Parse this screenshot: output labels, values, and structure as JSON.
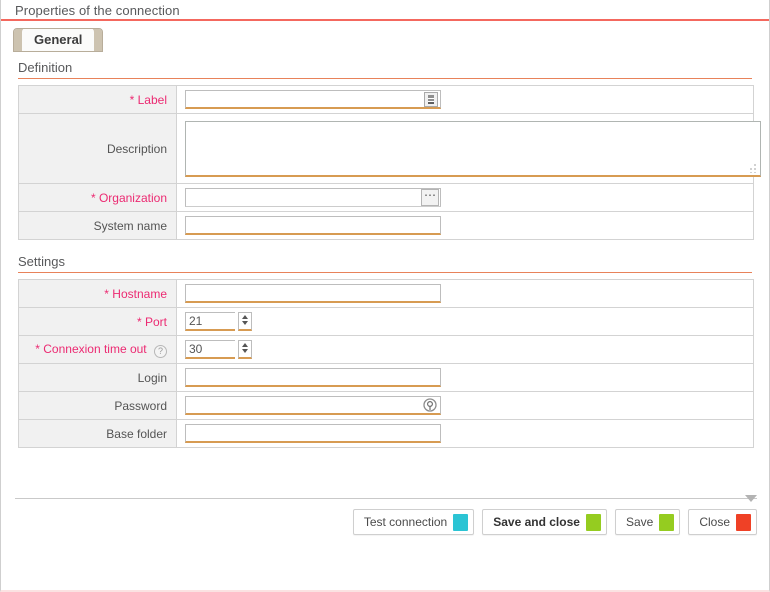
{
  "window": {
    "title": "Properties of the connection"
  },
  "tabs": [
    {
      "label": "General",
      "active": true
    }
  ],
  "sections": [
    {
      "id": "definition",
      "heading": "Definition",
      "fields": [
        {
          "label": "Label",
          "required": true,
          "type": "text",
          "value": "",
          "trailing_icon": "translate-icon"
        },
        {
          "label": "Description",
          "required": false,
          "type": "textarea",
          "value": ""
        },
        {
          "label": "Organization",
          "required": true,
          "type": "text",
          "value": "",
          "trailing_icon": "ellipsis-browse-icon"
        },
        {
          "label": "System name",
          "required": false,
          "type": "text",
          "value": ""
        }
      ]
    },
    {
      "id": "settings",
      "heading": "Settings",
      "fields": [
        {
          "label": "Hostname",
          "required": true,
          "type": "text",
          "value": ""
        },
        {
          "label": "Port",
          "required": true,
          "type": "spinner",
          "value": "21"
        },
        {
          "label": "Connexion time out",
          "required": true,
          "type": "spinner",
          "value": "30",
          "help_icon": "?"
        },
        {
          "label": "Login",
          "required": false,
          "type": "text",
          "value": ""
        },
        {
          "label": "Password",
          "required": false,
          "type": "password",
          "value": "",
          "trailing_icon": "key-reveal-icon"
        },
        {
          "label": "Base folder",
          "required": false,
          "type": "text",
          "value": ""
        }
      ]
    }
  ],
  "footer": {
    "buttons": [
      {
        "label": "Test connection",
        "chip_color": "#2bc4d4",
        "bold": false
      },
      {
        "label": "Save and close",
        "chip_color": "#95cc20",
        "bold": true
      },
      {
        "label": "Save",
        "chip_color": "#95cc20",
        "bold": false
      },
      {
        "label": "Close",
        "chip_color": "#ef4126",
        "bold": false
      }
    ],
    "collapse_caret": "collapse-caret-icon"
  },
  "colors": {
    "title_underline": "#f4685e",
    "section_underline": "#e8825a",
    "required_label": "#ec2a72",
    "input_underline": "#d79b52",
    "label_cell_bg": "#f1f1f1"
  },
  "field_labels": {
    "label": "Label",
    "description": "Description",
    "organization": "Organization",
    "system_name": "System name",
    "hostname": "Hostname",
    "port": "Port",
    "connexion_time_out": "Connexion time out",
    "login": "Login",
    "password": "Password",
    "base_folder": "Base folder",
    "star": "*"
  }
}
